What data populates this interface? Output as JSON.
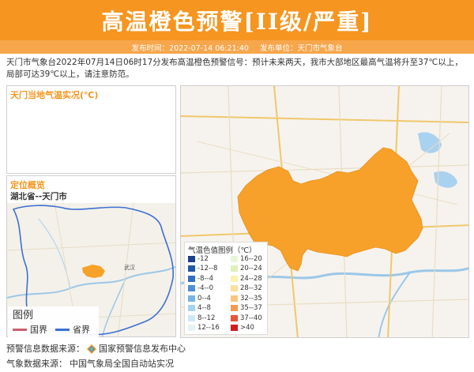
{
  "header": {
    "title": "高温橙色预警[II级/严重]",
    "publish_time": "发布时间：2022-07-14 06:21:40",
    "publisher": "发布单位：天门市气象台"
  },
  "description": "天门市气象台2022年07月14日06时17分发布高温橙色预警信号：预计未来两天，我市大部地区最高气温将升至37℃以上，局部可达39℃以上，请注意防范。",
  "local_temp": {
    "title": "天门当地气温实况(℃)"
  },
  "location": {
    "title": "定位概览",
    "region": "湖北省--天门市",
    "map_label": "武汉",
    "legend": {
      "title": "图例",
      "items": [
        {
          "label": "国界",
          "color": "#c9606f"
        },
        {
          "label": "省界",
          "color": "#3d6fd1"
        }
      ]
    }
  },
  "temp_legend": {
    "title": "气温色值图例（℃）",
    "items": [
      {
        "label": "-12",
        "color": "#1c3f8f"
      },
      {
        "label": "-12--8",
        "color": "#2458a8"
      },
      {
        "label": "-8--4",
        "color": "#3470c2"
      },
      {
        "label": "-4--0",
        "color": "#4f8fd6"
      },
      {
        "label": "0--4",
        "color": "#78b4e8"
      },
      {
        "label": "4--8",
        "color": "#a6d3f2"
      },
      {
        "label": "8--12",
        "color": "#cce8f7"
      },
      {
        "label": "12--16",
        "color": "#e4f4f2"
      },
      {
        "label": "16--20",
        "color": "#e8f6d8"
      },
      {
        "label": "20--24",
        "color": "#dff0b8"
      },
      {
        "label": "24--28",
        "color": "#fbf2b2"
      },
      {
        "label": "28--32",
        "color": "#fbdfa0"
      },
      {
        "label": "32--35",
        "color": "#f9c583"
      },
      {
        "label": "35--37",
        "color": "#f59a54"
      },
      {
        "label": "37--40",
        "color": "#e8533a"
      },
      {
        "label": ">40",
        "color": "#d21c1c"
      }
    ]
  },
  "sources": {
    "warning_label": "预警信息数据来源：",
    "warning_value": "国家预警信息发布中心",
    "weather_label": "气象数据来源：",
    "weather_value": "中国气象局全国自动站实况"
  },
  "colors": {
    "brand_orange": "#f6951f",
    "warning_area": "#f7a12a"
  }
}
